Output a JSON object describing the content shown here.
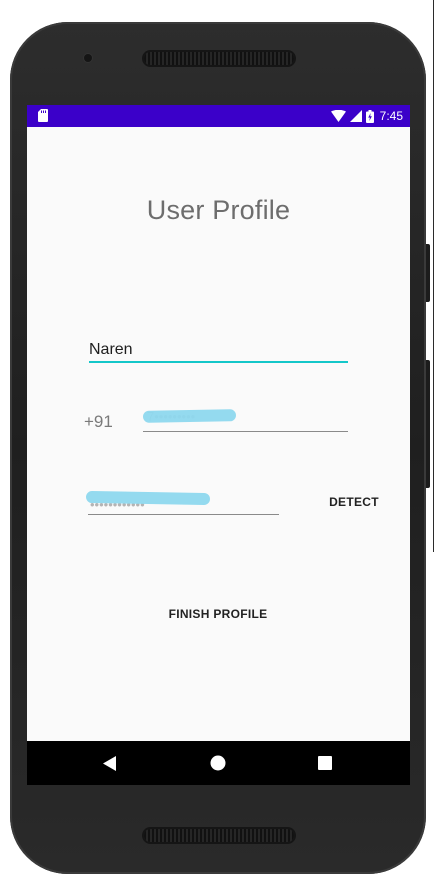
{
  "status_bar": {
    "time": "7:45",
    "background": "#3b00c9",
    "icons": [
      "sd-card-icon",
      "wifi-icon",
      "cell-signal-icon",
      "battery-charging-icon"
    ]
  },
  "page": {
    "title": "User Profile"
  },
  "form": {
    "name": {
      "value": "Naren",
      "underline_color": "#14c7c9"
    },
    "phone": {
      "country_code": "+91",
      "value_redacted": true
    },
    "location": {
      "value_redacted": true
    },
    "detect_label": "DETECT",
    "finish_label": "FINISH PROFILE"
  },
  "nav_bar": {
    "buttons": [
      "back-icon",
      "home-icon",
      "recents-icon"
    ]
  },
  "colors": {
    "accent": "#14c7c9",
    "redaction": "#8ed8ee",
    "status_bar": "#3b00c9"
  }
}
